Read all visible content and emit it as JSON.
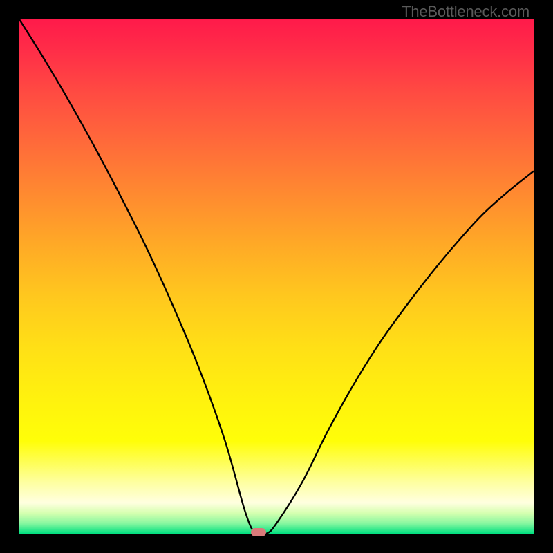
{
  "attribution": "TheBottleneck.com",
  "chart_data": {
    "type": "line",
    "title": "",
    "xlabel": "",
    "ylabel": "",
    "xlim": [
      0,
      100
    ],
    "ylim": [
      0,
      100
    ],
    "series": [
      {
        "name": "bottleneck-curve",
        "x": [
          0,
          5,
          10,
          15,
          20,
          25,
          30,
          35,
          40,
          44,
          46,
          48,
          50,
          55,
          60,
          65,
          70,
          75,
          80,
          85,
          90,
          95,
          100
        ],
        "values": [
          100,
          92,
          83.5,
          74.5,
          65,
          55,
          44,
          32,
          18,
          4,
          0,
          0,
          2,
          10,
          20,
          29,
          37,
          44,
          50.5,
          56.5,
          62,
          66.5,
          70.5
        ]
      }
    ],
    "optimum_marker": {
      "x": 46.5,
      "y": 0
    },
    "background_gradient": {
      "top_color": "#ff1a4a",
      "mid_color": "#ffe016",
      "bottom_color": "#00e080"
    }
  }
}
